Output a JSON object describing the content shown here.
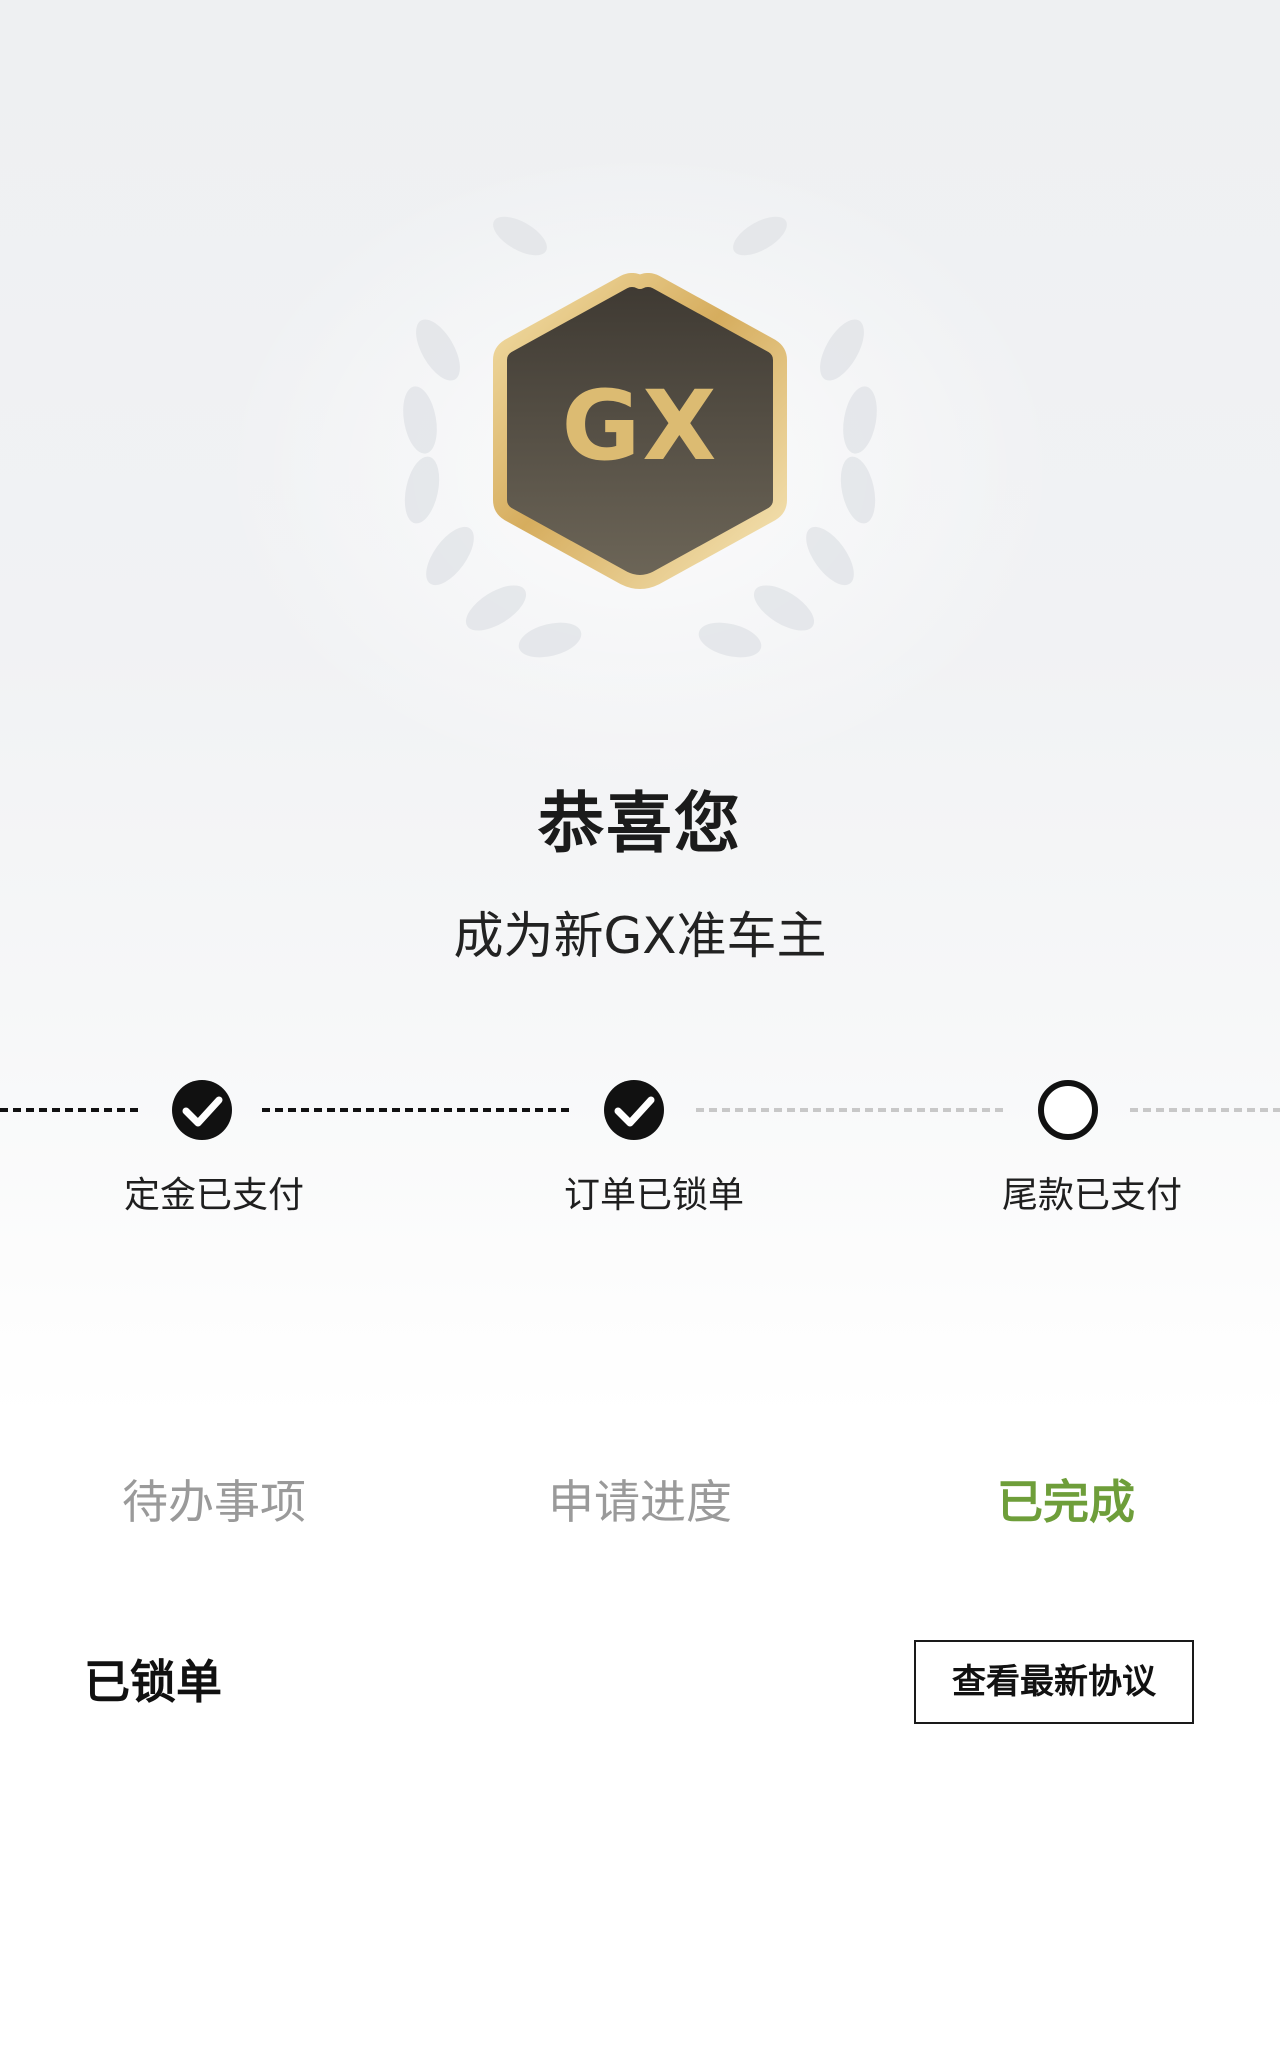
{
  "badge": {
    "logo_text": "GX"
  },
  "congrats": {
    "title": "恭喜您",
    "subtitle": "成为新GX准车主"
  },
  "progress": {
    "steps": [
      {
        "label": "定金已支付",
        "status": "done"
      },
      {
        "label": "订单已锁单",
        "status": "done"
      },
      {
        "label": "尾款已支付",
        "status": "pending"
      }
    ]
  },
  "tabs": {
    "items": [
      {
        "label": "待办事项",
        "active": false
      },
      {
        "label": "申请进度",
        "active": false
      },
      {
        "label": "已完成",
        "active": true
      }
    ]
  },
  "section": {
    "title": "已锁单",
    "view_agreement_label": "查看最新协议"
  },
  "colors": {
    "accent_green": "#6e9e3a",
    "gold": "#d8b46a",
    "badge_dark": "#4a443c"
  },
  "icons": {
    "done": "check-circle-icon",
    "pending": "empty-circle-icon",
    "laurel": "laurel-wreath-icon"
  }
}
